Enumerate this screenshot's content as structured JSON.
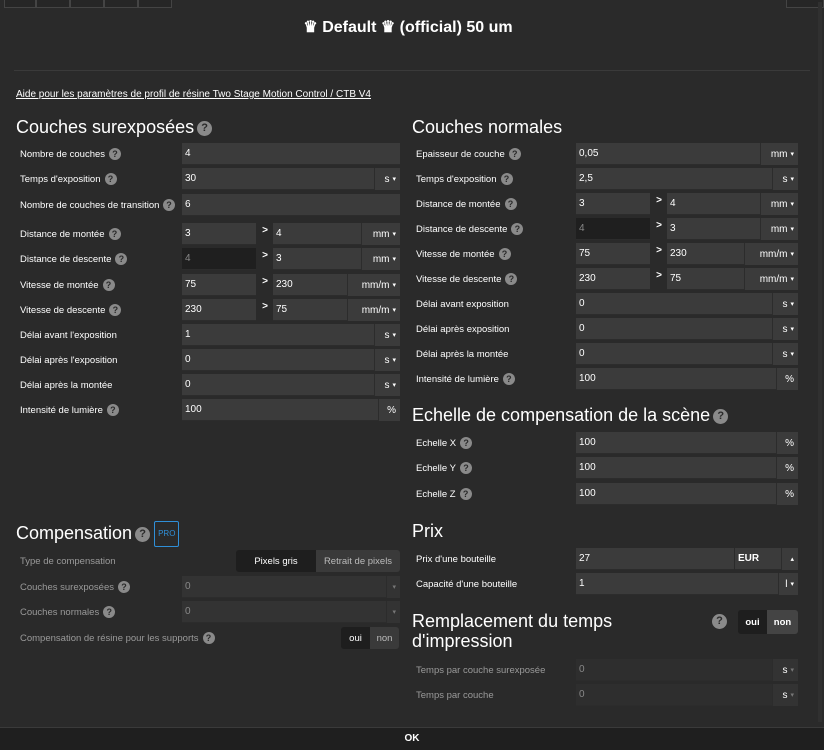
{
  "dialog": {
    "title": "♛ Default ♛ (official) 50 um",
    "help_link": "Aide pour les paramètres de profil de résine Two Stage Motion Control / CTB V4",
    "ok_label": "OK"
  },
  "overexposed": {
    "title": "Couches surexposées",
    "rows": {
      "count": {
        "label": "Nombre de couches",
        "value": "4"
      },
      "exposure": {
        "label": "Temps d'exposition",
        "value": "30",
        "unit": "s"
      },
      "transition": {
        "label": "Nombre de couches de transition",
        "value": "6"
      },
      "lift_dist": {
        "label": "Distance de montée",
        "from": "3",
        "to": "4",
        "unit": "mm"
      },
      "retract_dist": {
        "label": "Distance de descente",
        "from": "4",
        "to": "3",
        "unit": "mm"
      },
      "lift_speed": {
        "label": "Vitesse de montée",
        "from": "75",
        "to": "230",
        "unit": "mm/m"
      },
      "retract_speed": {
        "label": "Vitesse de descente",
        "from": "230",
        "to": "75",
        "unit": "mm/m"
      },
      "wait_before": {
        "label": "Délai avant l'exposition",
        "value": "1",
        "unit": "s"
      },
      "wait_after": {
        "label": "Délai après l'exposition",
        "value": "0",
        "unit": "s"
      },
      "wait_lift": {
        "label": "Délai après la montée",
        "value": "0",
        "unit": "s"
      },
      "light": {
        "label": "Intensité de lumière",
        "value": "100",
        "unit": "%"
      }
    }
  },
  "normal": {
    "title": "Couches normales",
    "rows": {
      "thickness": {
        "label": "Epaisseur de couche",
        "value": "0,05",
        "unit": "mm"
      },
      "exposure": {
        "label": "Temps d'exposition",
        "value": "2,5",
        "unit": "s"
      },
      "lift_dist": {
        "label": "Distance de montée",
        "from": "3",
        "to": "4",
        "unit": "mm"
      },
      "retract_dist": {
        "label": "Distance de descente",
        "from": "4",
        "to": "3",
        "unit": "mm"
      },
      "lift_speed": {
        "label": "Vitesse de montée",
        "from": "75",
        "to": "230",
        "unit": "mm/m"
      },
      "retract_speed": {
        "label": "Vitesse de descente",
        "from": "230",
        "to": "75",
        "unit": "mm/m"
      },
      "wait_before": {
        "label": "Délai avant exposition",
        "value": "0",
        "unit": "s"
      },
      "wait_after": {
        "label": "Délai après exposition",
        "value": "0",
        "unit": "s"
      },
      "wait_lift": {
        "label": "Délai après la montée",
        "value": "0",
        "unit": "s"
      },
      "light": {
        "label": "Intensité de lumière",
        "value": "100",
        "unit": "%"
      }
    }
  },
  "scale": {
    "title": "Echelle de compensation de la scène",
    "x": {
      "label": "Echelle X",
      "value": "100",
      "unit": "%"
    },
    "y": {
      "label": "Echelle Y",
      "value": "100",
      "unit": "%"
    },
    "z": {
      "label": "Echelle Z",
      "value": "100",
      "unit": "%"
    }
  },
  "compensation": {
    "title": "Compensation",
    "badge": "PRO",
    "type_label": "Type de compensation",
    "type_options": [
      "Pixels gris",
      "Retrait de pixels"
    ],
    "over_label": "Couches surexposées",
    "over_value": "0",
    "normal_label": "Couches normales",
    "normal_value": "0",
    "support_label": "Compensation de résine pour les supports",
    "yes": "oui",
    "no": "non"
  },
  "price": {
    "title": "Prix",
    "bottle_price_label": "Prix d'une bouteille",
    "bottle_price_value": "27",
    "currency": "EUR",
    "capacity_label": "Capacité d'une bouteille",
    "capacity_value": "1",
    "capacity_unit": "l"
  },
  "print_time": {
    "title": "Remplacement du temps d'impression",
    "yes": "oui",
    "no": "non",
    "over_label": "Temps par couche surexposée",
    "over_value": "0",
    "over_unit": "s",
    "layer_label": "Temps par couche",
    "layer_value": "0",
    "layer_unit": "s"
  }
}
